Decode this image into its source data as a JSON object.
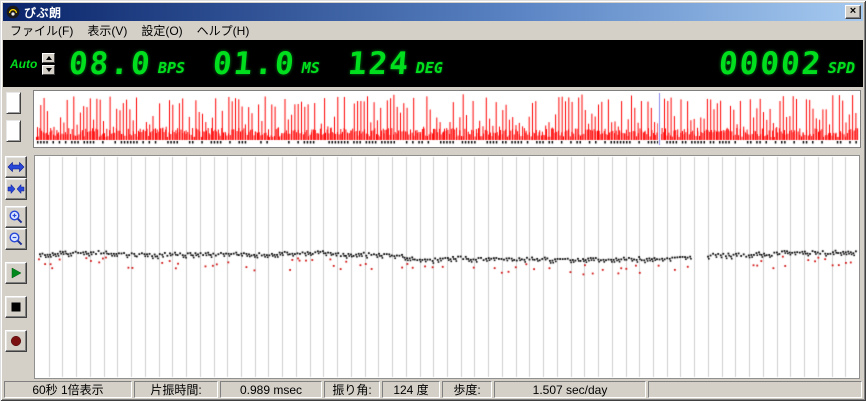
{
  "window": {
    "title": "びぶ朗",
    "close_glyph": "×"
  },
  "menu": {
    "items": [
      {
        "label": "ファイル(F)"
      },
      {
        "label": "表示(V)"
      },
      {
        "label": "設定(O)"
      },
      {
        "label": "ヘルプ(H)"
      }
    ]
  },
  "led": {
    "auto_label": "Auto",
    "groups": [
      {
        "value": "08.0",
        "unit": "BPS"
      },
      {
        "value": "01.0",
        "unit": "MS"
      },
      {
        "value": "124",
        "unit": "DEG"
      }
    ],
    "counter": {
      "value": "00002",
      "unit": "SPD"
    },
    "text_color": "#00df1e",
    "background": "#000000"
  },
  "waveform": {
    "spike_color": "#ff0000",
    "tick_color": "#000000",
    "cursor_color": "#8c8cf0",
    "cursor_pos": 0.757,
    "seed": 7
  },
  "plot": {
    "grid_divisions": 60,
    "grid_color": "#cfcfcf",
    "trace_center": 0.44,
    "gap_start": 0.795,
    "gap_end": 0.815,
    "dot_color": "#000000",
    "outlier_color": "#d01010",
    "seed": 13
  },
  "statusbar": {
    "panels": [
      {
        "text": "60秒 1倍表示"
      },
      {
        "text": "片振時間:"
      },
      {
        "text": "0.989 msec"
      },
      {
        "text": "振り角:"
      },
      {
        "text": "124 度"
      },
      {
        "text": "歩度:"
      },
      {
        "text": "1.507 sec/day"
      },
      {
        "text": ""
      }
    ]
  }
}
